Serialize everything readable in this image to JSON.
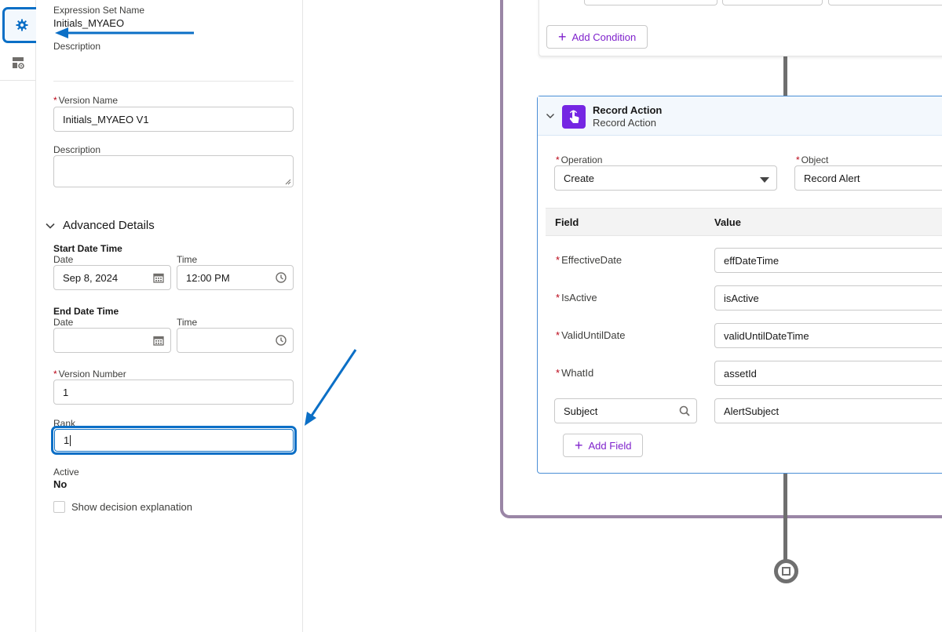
{
  "rail": {
    "settings_icon": "gear-icon",
    "layout_icon": "layout-settings-icon"
  },
  "panel": {
    "expression_set_name_label": "Expression Set Name",
    "expression_set_name_value": "Initials_MYAEO",
    "description_label": "Description",
    "version_name_label": "Version Name",
    "version_name_value": "Initials_MYAEO V1",
    "version_description_label": "Description",
    "advanced_details_title": "Advanced Details",
    "start_date_time_label": "Start Date Time",
    "start_date_label": "Date",
    "start_date_value": "Sep 8, 2024",
    "start_time_label": "Time",
    "start_time_value": "12:00 PM",
    "end_date_time_label": "End Date Time",
    "end_date_label": "Date",
    "end_time_label": "Time",
    "version_number_label": "Version Number",
    "version_number_value": "1",
    "rank_label": "Rank",
    "rank_value": "1",
    "active_label": "Active",
    "active_value": "No",
    "show_decision_label": "Show decision explanation"
  },
  "canvas": {
    "add_condition_label": "Add Condition",
    "record_action": {
      "title": "Record Action",
      "subtitle": "Record Action",
      "operation_label": "Operation",
      "operation_value": "Create",
      "object_label": "Object",
      "object_value": "Record Alert",
      "field_header": "Field",
      "value_header": "Value",
      "rows": [
        {
          "field": "EffectiveDate",
          "value": "effDateTime"
        },
        {
          "field": "IsActive",
          "value": "isActive"
        },
        {
          "field": "ValidUntilDate",
          "value": "validUntilDateTime"
        },
        {
          "field": "WhatId",
          "value": "assetId"
        }
      ],
      "subject_field": "Subject",
      "subject_value": "AlertSubject",
      "add_field_label": "Add Field"
    }
  },
  "colors": {
    "accent": "#0b6fc6",
    "purple": "#7f22cc",
    "frame": "#9a86a6",
    "required": "#ba0517"
  }
}
